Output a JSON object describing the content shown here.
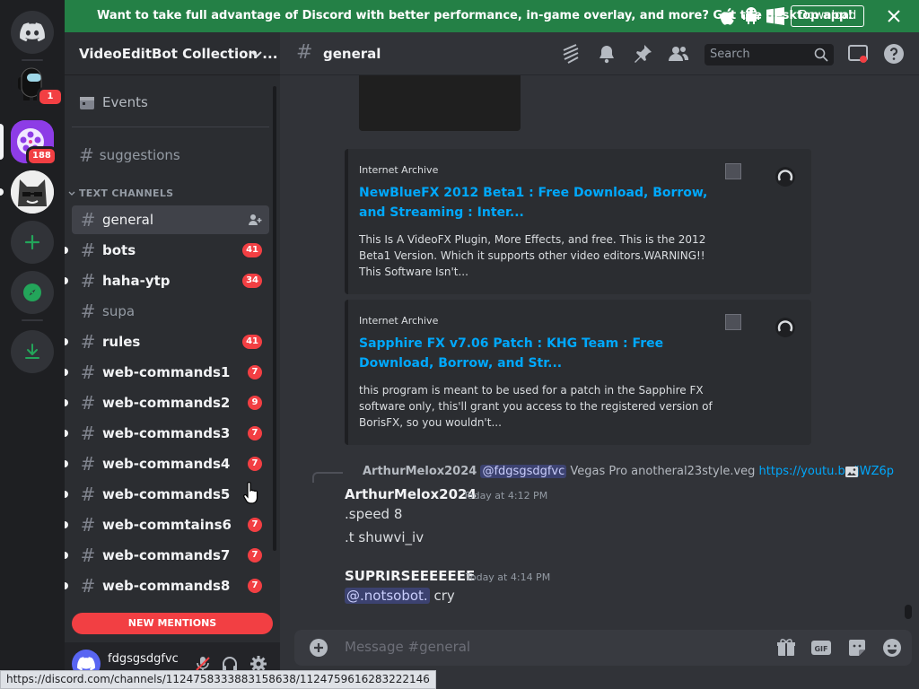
{
  "banner": {
    "text": "Want to take full advantage of Discord with better performance, in-game overlay, and more? Get the desktop app!",
    "button": "Download",
    "color": "#248046"
  },
  "servers": {
    "among_badge": "1",
    "video_badge": "188"
  },
  "guild": {
    "name": "VideoEditBot Collection ..."
  },
  "sidebar": {
    "events": "Events",
    "pinned_channel": "suggestions",
    "category": "TEXT CHANNELS",
    "channels": [
      {
        "name": "general",
        "badge": "",
        "state": "active"
      },
      {
        "name": "bots",
        "badge": "41",
        "state": "unread"
      },
      {
        "name": "haha-ytp",
        "badge": "34",
        "state": "unread"
      },
      {
        "name": "supa",
        "badge": "",
        "state": "muted"
      },
      {
        "name": "rules",
        "badge": "41",
        "state": "unread"
      },
      {
        "name": "web-commands1",
        "badge": "7",
        "state": "unread"
      },
      {
        "name": "web-commands2",
        "badge": "9",
        "state": "unread"
      },
      {
        "name": "web-commands3",
        "badge": "7",
        "state": "unread"
      },
      {
        "name": "web-commands4",
        "badge": "7",
        "state": "unread"
      },
      {
        "name": "web-commands5",
        "badge": "",
        "state": "hover"
      },
      {
        "name": "web-commtains6",
        "badge": "7",
        "state": "unread"
      },
      {
        "name": "web-commands7",
        "badge": "7",
        "state": "unread"
      },
      {
        "name": "web-commands8",
        "badge": "7",
        "state": "unread"
      }
    ],
    "new_mentions": "NEW MENTIONS"
  },
  "user": {
    "name": "fdgsgsdgfvc"
  },
  "header": {
    "channel": "general",
    "search_placeholder": "Search"
  },
  "embeds": [
    {
      "provider": "Internet Archive",
      "title": "NewBlueFX 2012 Beta1 : Free Download, Borrow, and Streaming : Inter...",
      "description": "This Is A VideoFX Plugin, More Effects, and free. This is the 2012 Beta1 Version. Which it supports other video editors.WARNING!! This Software Isn't..."
    },
    {
      "provider": "Internet Archive",
      "title": "Sapphire FX v7.06 Patch : KHG Team : Free Download, Borrow, and Str...",
      "description": "this program is meant to be used for a patch in the Sapphire FX software only, this'll grant you access to the registered version of BorisFX, so you wouldn't..."
    }
  ],
  "reply": {
    "user": "ArthurMelox2024",
    "mention": "@fdgsgsdgfvc",
    "text": "Vegas Pro anotheral23style.veg",
    "link": "https://youtu.be/jWZ6p"
  },
  "messages": [
    {
      "author": "ArthurMelox2024",
      "time": "Today at 4:12 PM",
      "lines": [
        ".speed 8",
        ".t shuwvi_iv"
      ]
    },
    {
      "author": "SUPRIRSEEEEEEE",
      "time": "Today at 4:14 PM",
      "mention": "@.notsobot.",
      "text": "cry"
    }
  ],
  "composer": {
    "placeholder": "Message #general"
  },
  "statusbar": {
    "url": "https://discord.com/channels/1124758333883158638/1124759616283222146"
  },
  "colors": {
    "accent": "#5865f2",
    "link": "#00a8fc",
    "badge": "#f23f43",
    "online_green": "#23a55a"
  }
}
